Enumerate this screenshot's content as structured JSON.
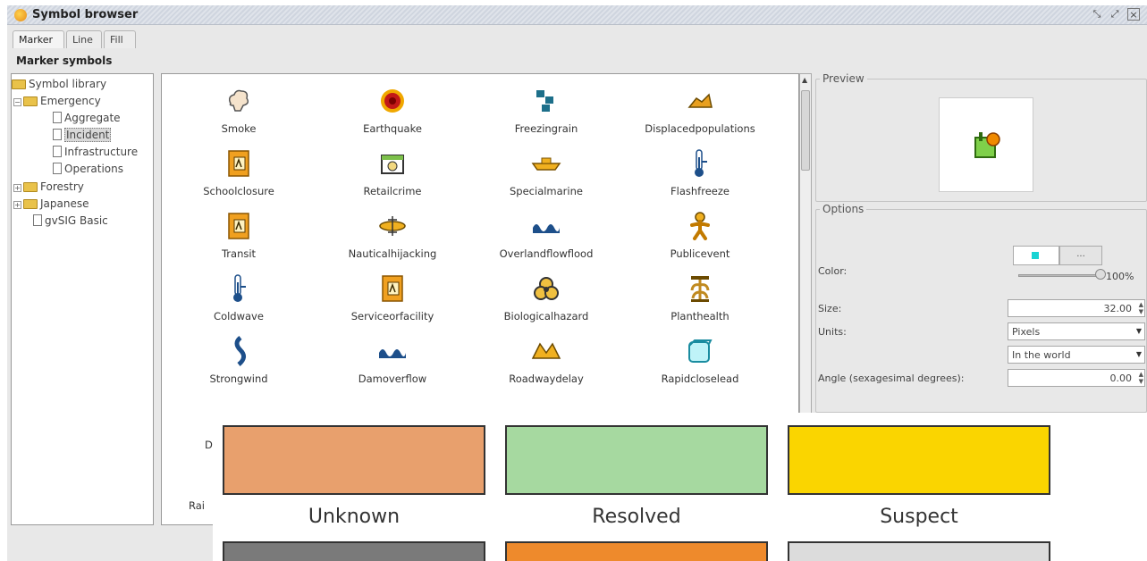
{
  "window": {
    "title": "Symbol browser",
    "controls": [
      "restore-icon",
      "maximize-icon",
      "close-icon"
    ]
  },
  "tabs": [
    {
      "label": "Marker",
      "active": true
    },
    {
      "label": "Line"
    },
    {
      "label": "Fill"
    }
  ],
  "section_title": "Marker symbols",
  "tree": {
    "root": "Symbol library",
    "emergency": "Emergency",
    "aggregate": "Aggregate",
    "incident": "Incident",
    "infrastructure": "Infrastructure",
    "operations": "Operations",
    "forestry": "Forestry",
    "japanese": "Japanese",
    "gvsig_basic": "gvSIG Basic"
  },
  "symbols": [
    {
      "name": "Smoke",
      "icon": "smoke-icon"
    },
    {
      "name": "Earthquake",
      "icon": "earthquake-icon"
    },
    {
      "name": "Freezingrain",
      "icon": "freezingrain-icon"
    },
    {
      "name": "Displacedpopulations",
      "icon": "displaced-icon"
    },
    {
      "name": "Schoolclosure",
      "icon": "doc-symbol-icon"
    },
    {
      "name": "Retailcrime",
      "icon": "retail-icon"
    },
    {
      "name": "Specialmarine",
      "icon": "boat-icon"
    },
    {
      "name": "Flashfreeze",
      "icon": "thermometer-icon"
    },
    {
      "name": "Transit",
      "icon": "doc-symbol-icon"
    },
    {
      "name": "Nauticalhijacking",
      "icon": "nautical-icon"
    },
    {
      "name": "Overlandflowflood",
      "icon": "wave-icon"
    },
    {
      "name": "Publicevent",
      "icon": "person-icon"
    },
    {
      "name": "Coldwave",
      "icon": "thermometer-icon"
    },
    {
      "name": "Serviceorfacility",
      "icon": "doc-symbol-icon"
    },
    {
      "name": "Biologicalhazard",
      "icon": "biohazard-icon"
    },
    {
      "name": "Planthealth",
      "icon": "plant-icon"
    },
    {
      "name": "Strongwind",
      "icon": "wind-icon"
    },
    {
      "name": "Damoverflow",
      "icon": "wave-icon"
    },
    {
      "name": "Roadwaydelay",
      "icon": "road-icon"
    },
    {
      "name": "Rapidcloselead",
      "icon": "cube-icon"
    }
  ],
  "partial_labels": {
    "row6_col1": "D",
    "row7_col1": "Rai"
  },
  "preview": {
    "legend": "Preview",
    "icon": "preview-symbol-icon"
  },
  "options": {
    "legend": "Options",
    "color_label": "Color:",
    "color_value": "#19d3d3",
    "color_button": "...",
    "transparency": "100%",
    "size_label": "Size:",
    "size_value": "32.00",
    "units_label": "Units:",
    "units_value": "Pixels",
    "units_ref_value": "In the world",
    "angle_label": "Angle (sexagesimal degrees):",
    "angle_value": "0.00"
  },
  "legend_boxes": [
    {
      "label": "Unknown",
      "color": "#e8a06d"
    },
    {
      "label": "Resolved",
      "color": "#a6d9a0"
    },
    {
      "label": "Suspect",
      "color": "#fad500"
    },
    {
      "label": "",
      "color": "#7a7a7a"
    },
    {
      "label": "",
      "color": "#ee8a2c"
    },
    {
      "label": "",
      "color": "#dcdcdc"
    }
  ]
}
